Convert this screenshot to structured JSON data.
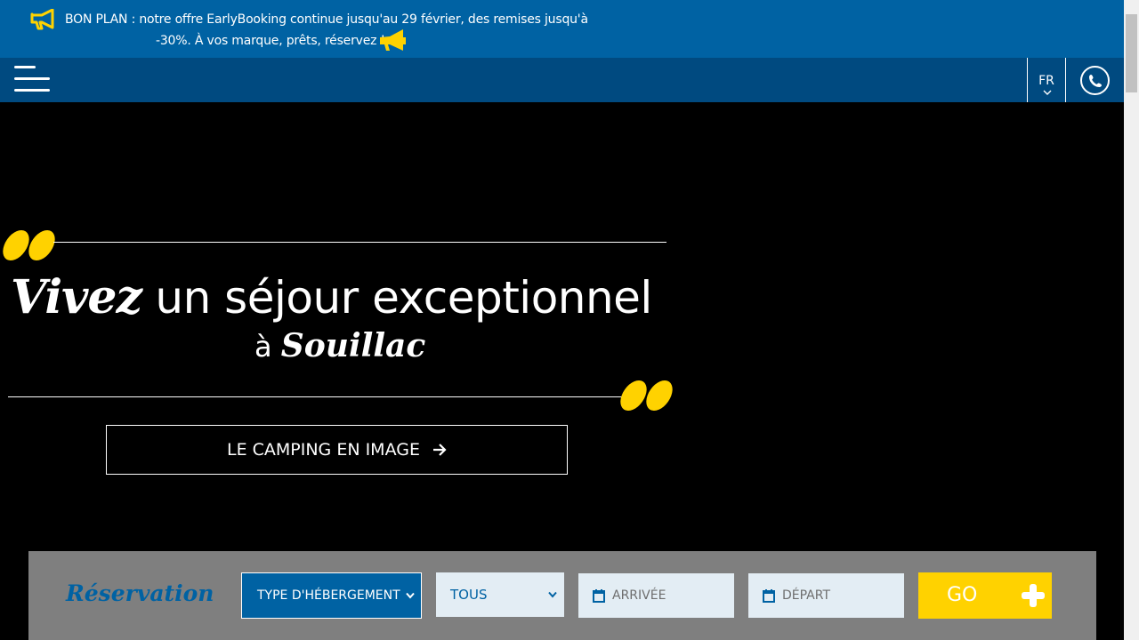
{
  "colors": {
    "promo_bg": "#0062a3",
    "nav_bg": "#004a80",
    "accent_yellow": "#ffd200",
    "booking_bg": "#7f7f7f",
    "field_bg": "#e3edf4"
  },
  "promo": {
    "line1": "BON PLAN : notre offre EarlyBooking continue jusqu'au 29 février, des remises jusqu'à",
    "line2": "-30%. À vos marque, prêts, réservez ! :",
    "icon_left": "megaphone-outline-icon",
    "icon_right": "megaphone-icon"
  },
  "nav": {
    "menu_icon": "hamburger-menu-icon",
    "language": "FR",
    "language_chevron": "chevron-down-icon",
    "phone_icon": "phone-icon"
  },
  "hero": {
    "title_script": "Vivez",
    "title_rest": " un séjour exceptionnel",
    "sub_prefix": "à ",
    "sub_town": "Souillac",
    "cta_label": "LE CAMPING EN IMAGE",
    "cta_icon": "arrow-right-icon",
    "quote_icon": "quote-mark-icon"
  },
  "booking": {
    "title": "Réservation",
    "type_select": "TYPE D'HÉBERGEMENT",
    "all_select": "TOUS",
    "arrival_placeholder": "ARRIVÉE",
    "departure_placeholder": "DÉPART",
    "calendar_icon": "calendar-icon",
    "go_label": "GO",
    "go_icon": "plus-icon"
  }
}
